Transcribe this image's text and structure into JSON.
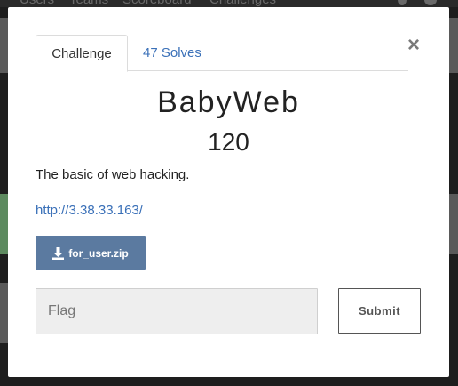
{
  "background": {
    "nav_items": [
      "Users",
      "Teams",
      "Scoreboard",
      "Challenges"
    ]
  },
  "modal": {
    "close_label": "×",
    "tabs": [
      {
        "label": "Challenge",
        "active": true
      },
      {
        "label": "47 Solves",
        "active": false
      }
    ],
    "challenge": {
      "name": "BabyWeb",
      "value": "120",
      "description": "The basic of web hacking.",
      "link": "http://3.38.33.163/",
      "file_label": "for_user.zip"
    },
    "flag": {
      "placeholder": "Flag",
      "value": ""
    },
    "submit_label": "Submit"
  },
  "colors": {
    "accent": "#3a70b8",
    "file_button": "#5b7aa0",
    "backdrop": "#1e1e1e"
  },
  "icons": {
    "file": "download-icon",
    "close": "close-icon"
  }
}
